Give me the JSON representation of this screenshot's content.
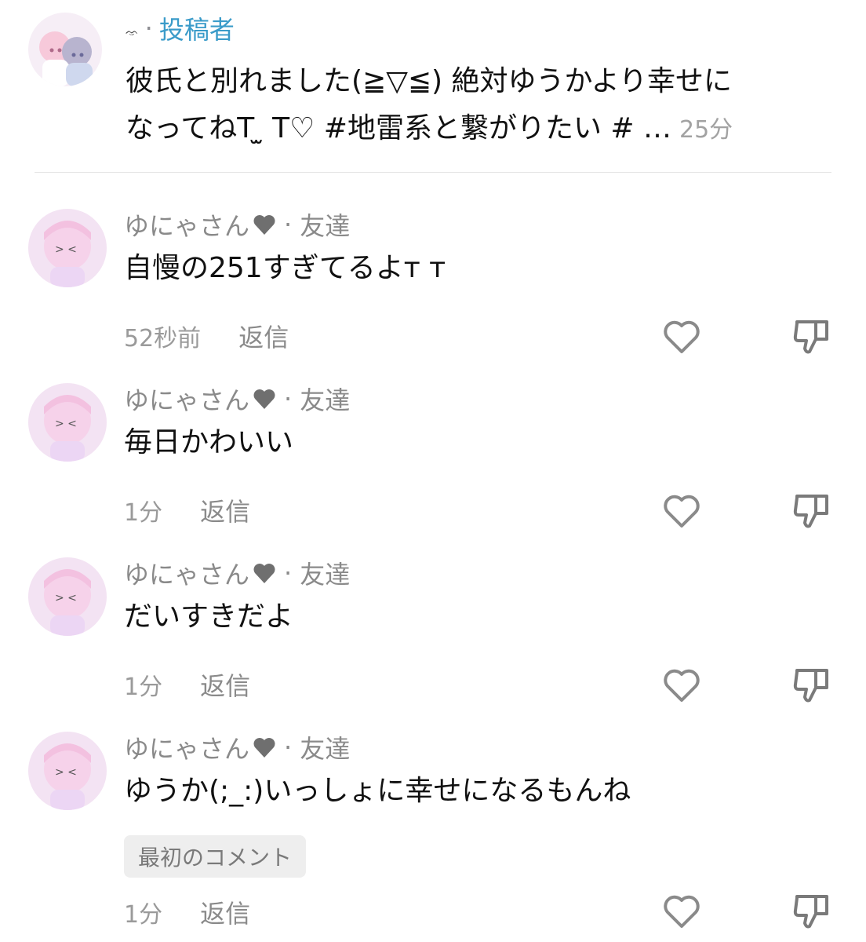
{
  "post": {
    "author_handle": "ᨎ",
    "separator": "·",
    "role_label": "投稿者",
    "text_line1": "彼氏と別れました(≧▽≦) 絶対ゆうかより幸せに",
    "text_line2": "なってねT ̫ T♡ #地雷系と繋がりたい # …",
    "time": "25分",
    "accent_color": "#3a9bc9"
  },
  "comments": [
    {
      "name": "ゆにゃさん",
      "separator": "·",
      "relation": "友達",
      "text": "自慢の251すぎてるよт т",
      "time": "52秒前",
      "reply_label": "返信",
      "badge": ""
    },
    {
      "name": "ゆにゃさん",
      "separator": "·",
      "relation": "友達",
      "text": "毎日かわいい",
      "time": "1分",
      "reply_label": "返信",
      "badge": ""
    },
    {
      "name": "ゆにゃさん",
      "separator": "·",
      "relation": "友達",
      "text": "だいすきだよ",
      "time": "1分",
      "reply_label": "返信",
      "badge": ""
    },
    {
      "name": "ゆにゃさん",
      "separator": "·",
      "relation": "友達",
      "text": "ゆうか(;_:)いっしょに幸せになるもんね",
      "time": "1分",
      "reply_label": "返信",
      "badge": "最初のコメント"
    }
  ],
  "icons": {
    "like": "heart-outline-icon",
    "dislike": "thumbs-down-icon",
    "name_suffix": "heart-icon"
  }
}
